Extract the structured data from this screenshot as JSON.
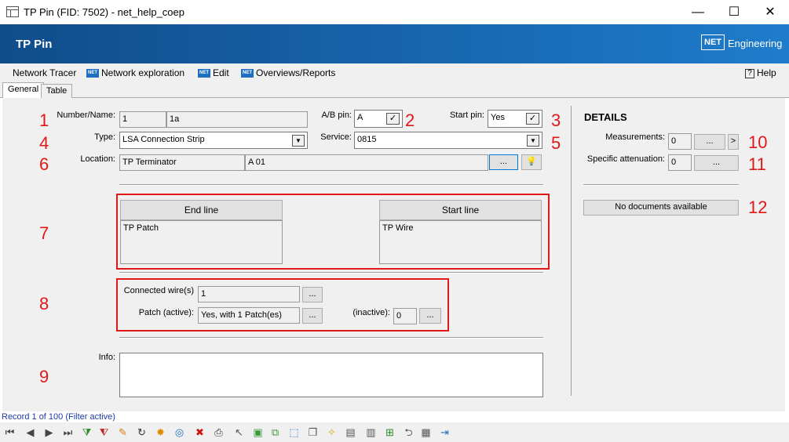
{
  "window": {
    "title": "TP Pin (FID: 7502) - net_help_coep",
    "minimize_glyph": "—",
    "maximize_glyph": "☐",
    "close_glyph": "✕"
  },
  "header": {
    "title": "TP Pin",
    "logo_mark": "NET",
    "logo_text": "Engineering"
  },
  "menu": {
    "items": [
      {
        "label": "Network Tracer",
        "icon": "none"
      },
      {
        "label": "Network exploration",
        "icon": "net-icon"
      },
      {
        "label": "Edit",
        "icon": "net-icon"
      },
      {
        "label": "Overviews/Reports",
        "icon": "net-icon"
      }
    ],
    "help": "Help",
    "net_icon_text": "NET"
  },
  "tabs": [
    {
      "label": "General",
      "active": true
    },
    {
      "label": "Table",
      "active": false
    }
  ],
  "annotations": [
    "1",
    "2",
    "3",
    "4",
    "5",
    "6",
    "7",
    "8",
    "9",
    "10",
    "11",
    "12"
  ],
  "form": {
    "number_name": {
      "label": "Number/Name:",
      "number": "1",
      "name": "1a"
    },
    "ab_pin": {
      "label": "A/B pin:",
      "value": "A",
      "check": "✓"
    },
    "start_pin": {
      "label": "Start pin:",
      "value": "Yes",
      "check": "✓"
    },
    "type": {
      "label": "Type:",
      "value": "LSA Connection Strip",
      "arrow": "▼"
    },
    "service": {
      "label": "Service:",
      "value": "0815",
      "arrow": "▼"
    },
    "location": {
      "label": "Location:",
      "value1": "TP Terminator",
      "value2": "A 01",
      "browse": "...",
      "bulb": "💡"
    },
    "end_line": {
      "header": "End line",
      "value": "TP Patch"
    },
    "start_line": {
      "header": "Start line",
      "value": "TP Wire"
    },
    "connected_wires": {
      "label": "Connected wire(s)",
      "value": "1",
      "browse": "..."
    },
    "patch_active": {
      "label": "Patch (active):",
      "value": "Yes, with 1 Patch(es)",
      "browse": "..."
    },
    "inactive": {
      "label": "(inactive):",
      "value": "0",
      "browse": "..."
    },
    "info": {
      "label": "Info:",
      "value": ""
    }
  },
  "details": {
    "title": "DETAILS",
    "measurements": {
      "label": "Measurements:",
      "value": "0",
      "browse": "...",
      "next": ">"
    },
    "specific_attenuation": {
      "label": "Specific attenuation:",
      "value": "0",
      "browse": "..."
    },
    "documents": "No documents available"
  },
  "status": {
    "record_text": "Record 1 of 100 (Filter active)"
  },
  "toolbar": {
    "icons": [
      {
        "name": "first-record-icon",
        "glyph": "⏮",
        "color": "#444"
      },
      {
        "name": "prev-record-icon",
        "glyph": "◀",
        "color": "#444"
      },
      {
        "name": "next-record-icon",
        "glyph": "▶",
        "color": "#444"
      },
      {
        "name": "last-record-icon",
        "glyph": "⏭",
        "color": "#444"
      },
      {
        "name": "filter-add-icon",
        "glyph": "⧩",
        "color": "#2a8a2a"
      },
      {
        "name": "filter-remove-icon",
        "glyph": "⧨",
        "color": "#c02020"
      },
      {
        "name": "edit-pencil-icon",
        "glyph": "✎",
        "color": "#d08010"
      },
      {
        "name": "refresh-icon",
        "glyph": "↻",
        "color": "#333"
      },
      {
        "name": "new-star-icon",
        "glyph": "✹",
        "color": "#e08a00"
      },
      {
        "name": "globe-icon",
        "glyph": "◎",
        "color": "#1f6fc0"
      },
      {
        "name": "delete-icon",
        "glyph": "✖",
        "color": "#d01010"
      },
      {
        "name": "print-icon",
        "glyph": "⎙",
        "color": "#333"
      },
      {
        "name": "select-pointer-icon",
        "glyph": "↖",
        "color": "#555"
      },
      {
        "name": "cube-icon",
        "glyph": "▣",
        "color": "#3a9a3a"
      },
      {
        "name": "copy-cube-icon",
        "glyph": "⧉",
        "color": "#3a9a3a"
      },
      {
        "name": "select-area-icon",
        "glyph": "⬚",
        "color": "#1f6fc0"
      },
      {
        "name": "duplicate-icon",
        "glyph": "❐",
        "color": "#555"
      },
      {
        "name": "new-document-icon",
        "glyph": "✧",
        "color": "#d0a010"
      },
      {
        "name": "document-icon",
        "glyph": "▤",
        "color": "#555"
      },
      {
        "name": "document-search-icon",
        "glyph": "▥",
        "color": "#555"
      },
      {
        "name": "document-add-icon",
        "glyph": "⊞",
        "color": "#2a8a2a"
      },
      {
        "name": "network-icon",
        "glyph": "⮌",
        "color": "#555"
      },
      {
        "name": "table-edit-icon",
        "glyph": "▦",
        "color": "#555"
      },
      {
        "name": "exit-icon",
        "glyph": "⇥",
        "color": "#1f6fc0"
      }
    ]
  }
}
